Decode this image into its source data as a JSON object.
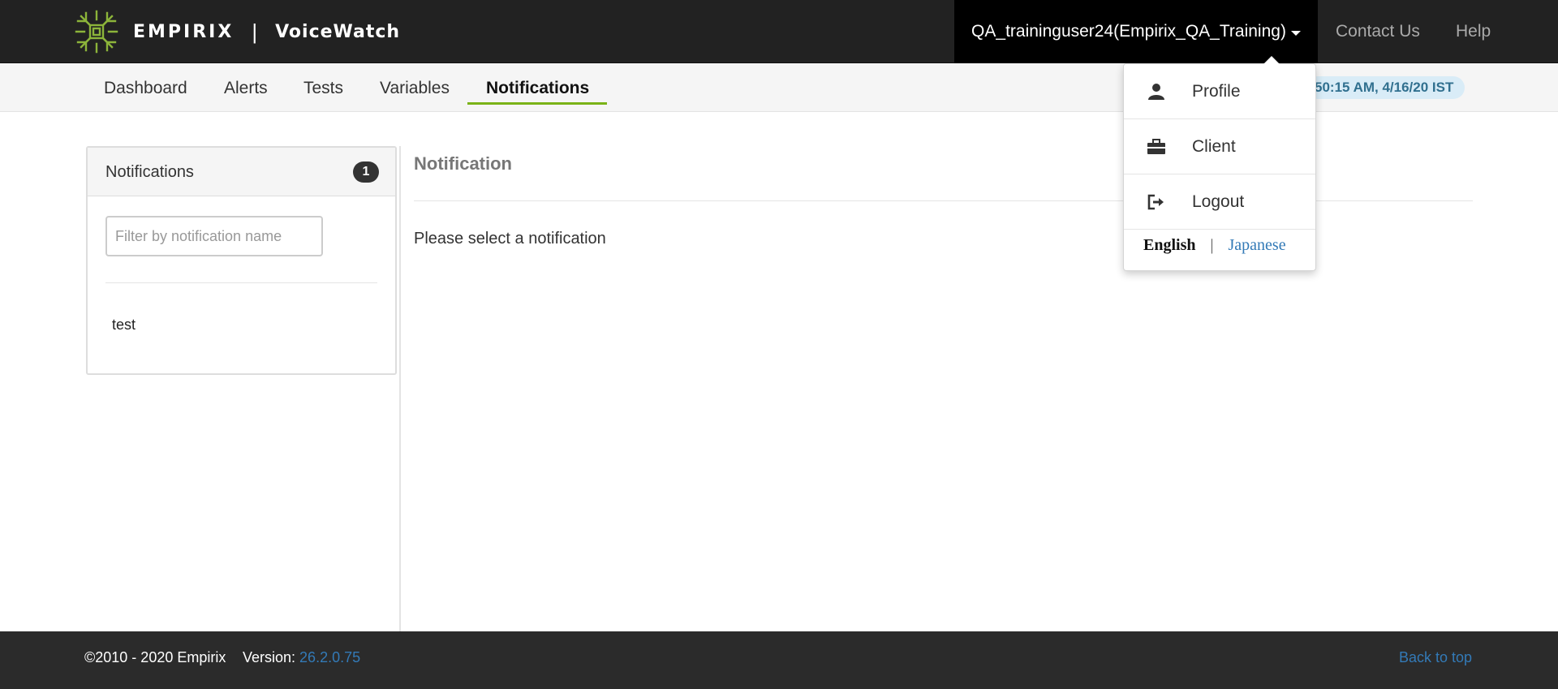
{
  "header": {
    "company": "EMPIRIX",
    "separator": "|",
    "product": "VoiceWatch",
    "user_label": "QA_traininguser24(Empirix_QA_Training)",
    "contact_label": "Contact Us",
    "help_label": "Help"
  },
  "nav": {
    "items": [
      {
        "label": "Dashboard"
      },
      {
        "label": "Alerts"
      },
      {
        "label": "Tests"
      },
      {
        "label": "Variables"
      },
      {
        "label": "Notifications",
        "active": true
      }
    ],
    "time_display": "50:15 AM, 4/16/20 IST"
  },
  "left_panel": {
    "title": "Notifications",
    "count": "1",
    "filter_placeholder": "Filter by notification name",
    "items": [
      "test"
    ]
  },
  "main": {
    "title": "Notification",
    "message": "Please select a notification"
  },
  "user_dropdown": {
    "items": [
      {
        "label": "Profile",
        "icon": "user-icon"
      },
      {
        "label": "Client",
        "icon": "briefcase-icon"
      },
      {
        "label": "Logout",
        "icon": "logout-icon"
      }
    ],
    "languages": {
      "english": "English",
      "separator": "|",
      "japanese": "Japanese"
    }
  },
  "footer": {
    "copyright": "©2010 - 2020 Empirix",
    "version_label": "Version:",
    "version_value": "26.2.0.75",
    "back_to_top": "Back to top"
  },
  "colors": {
    "header_bg": "#222222",
    "accent_green": "#7ab317",
    "link_blue": "#337ab7",
    "time_badge_bg": "#d9ecf7"
  }
}
